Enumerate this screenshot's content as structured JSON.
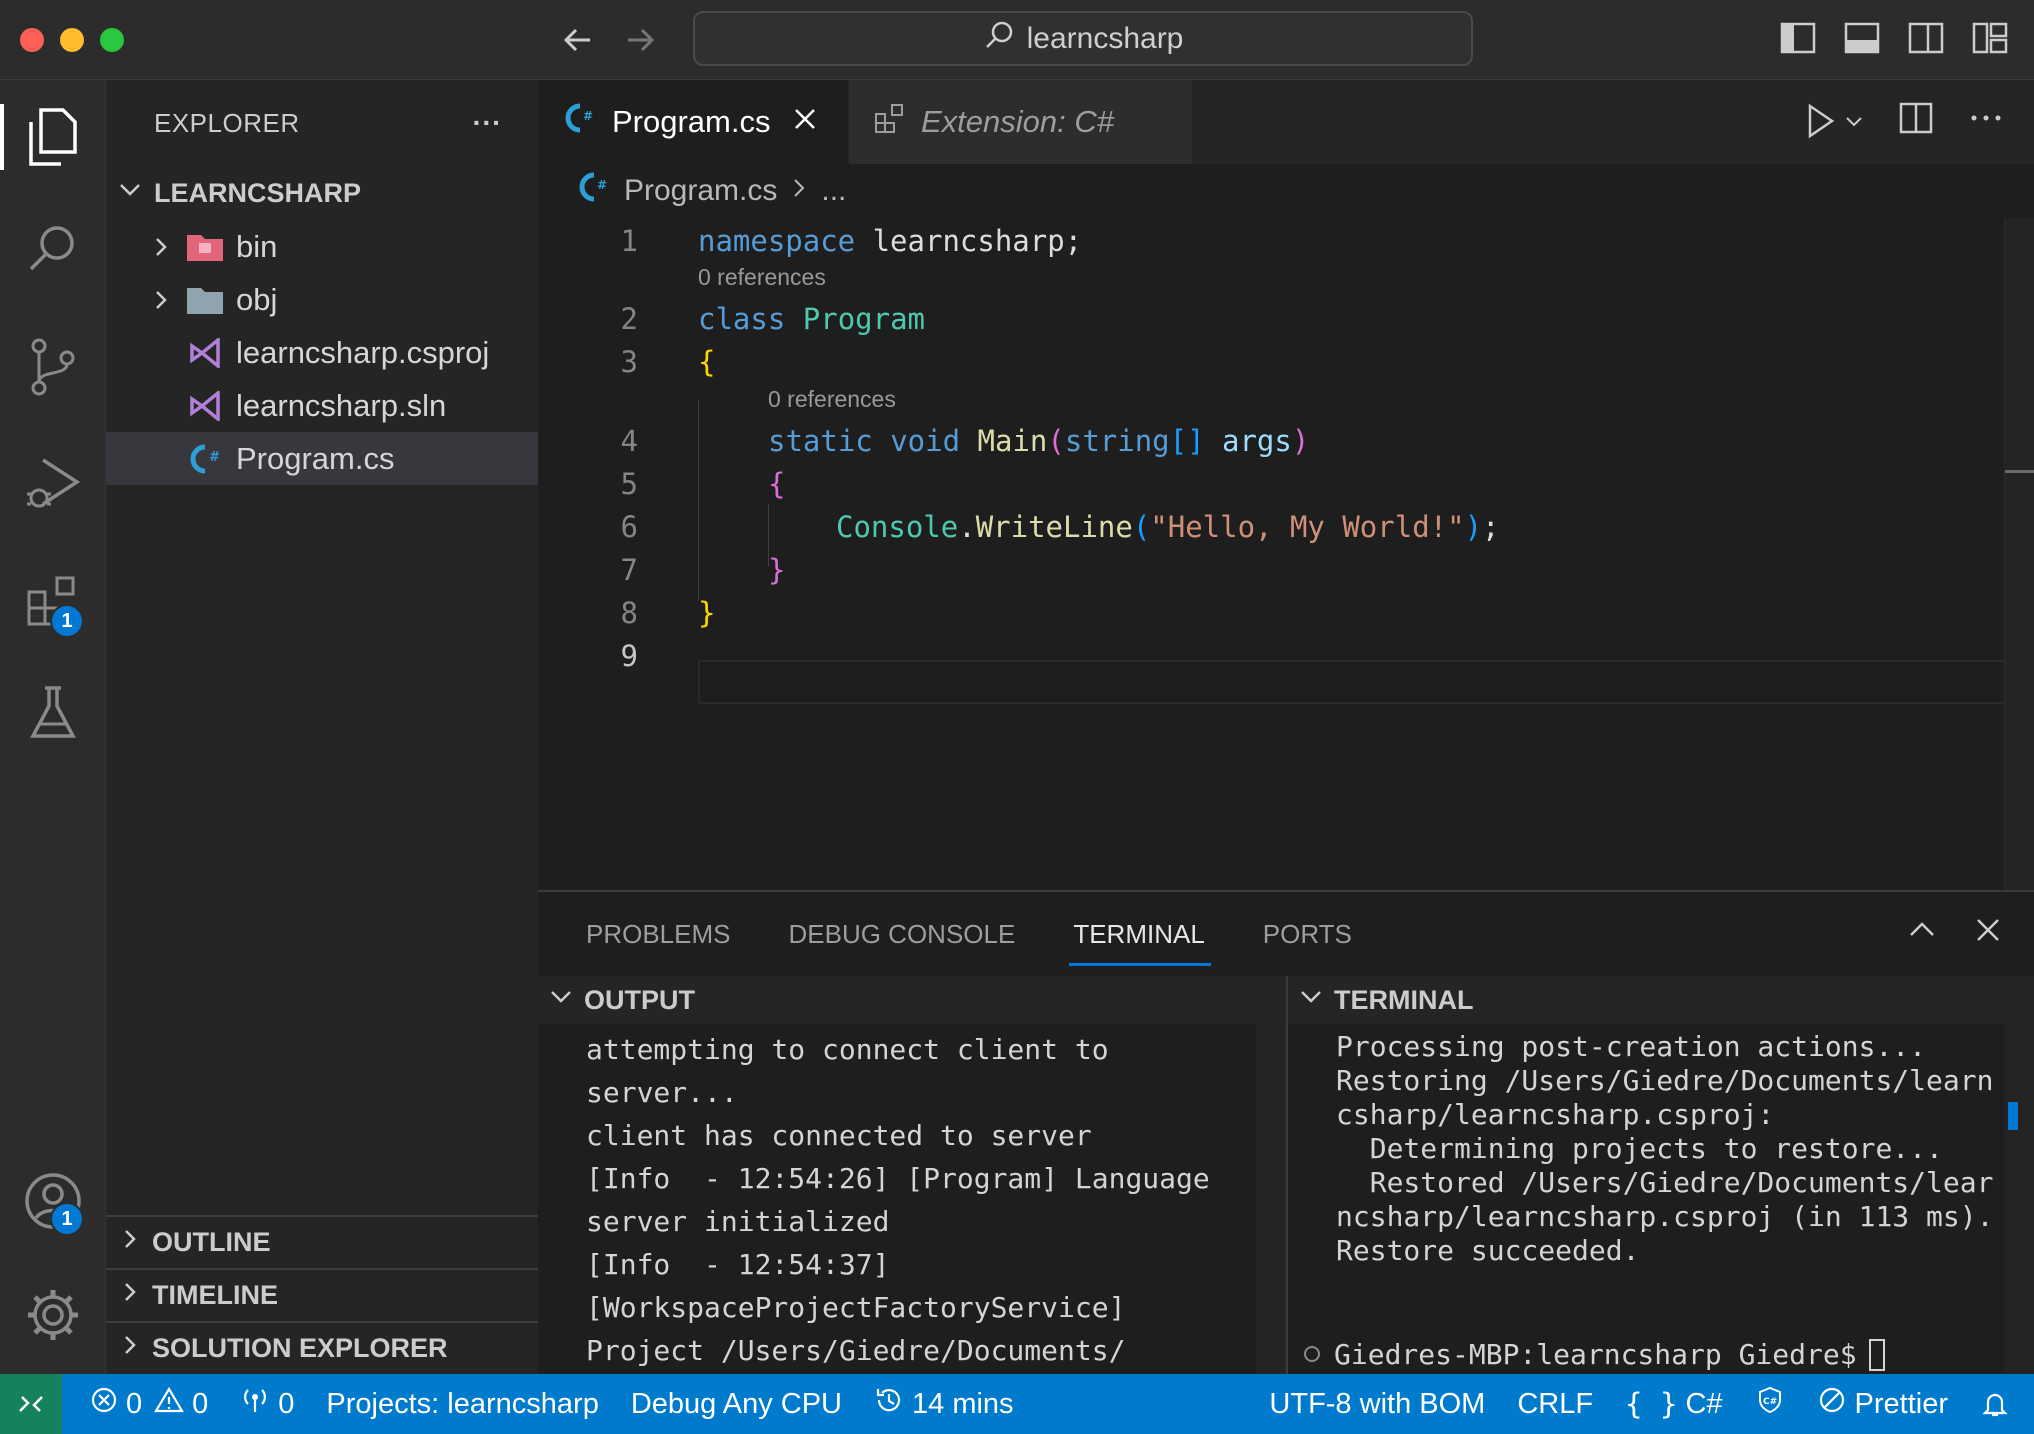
{
  "window": {
    "search_text": "learncsharp"
  },
  "activity": {
    "extensions_badge": "1",
    "accounts_badge": "1"
  },
  "explorer": {
    "header": "EXPLORER",
    "more": "···",
    "root": "LEARNCSHARP",
    "items": [
      {
        "label": "bin",
        "type": "folder-special"
      },
      {
        "label": "obj",
        "type": "folder"
      },
      {
        "label": "learncsharp.csproj",
        "type": "vs"
      },
      {
        "label": "learncsharp.sln",
        "type": "vs"
      },
      {
        "label": "Program.cs",
        "type": "cs"
      }
    ],
    "sections": [
      "OUTLINE",
      "TIMELINE",
      "SOLUTION EXPLORER"
    ]
  },
  "editor": {
    "tabs": [
      {
        "label": "Program.cs"
      },
      {
        "label": "Extension: C#"
      }
    ],
    "breadcrumb": {
      "file": "Program.cs",
      "rest": "..."
    },
    "codelens": [
      "0 references",
      "0 references"
    ],
    "line_numbers": [
      "1",
      "2",
      "3",
      "4",
      "5",
      "6",
      "7",
      "8",
      "9"
    ],
    "code": {
      "l1_kw": "namespace",
      "l1_rest": " learncsharp;",
      "l2_kw": "class",
      "l2_name": " Program",
      "l3": "{",
      "l4_static": "static",
      "l4_void": " void",
      "l4_main": " Main",
      "l4_paren_open": "(",
      "l4_string": "string",
      "l4_arr": "[]",
      "l4_args": " args",
      "l4_paren_close": ")",
      "l5": "{",
      "l6_console": "Console",
      "l6_dot": ".",
      "l6_method": "WriteLine",
      "l6_po": "(",
      "l6_str": "\"Hello, My World!\"",
      "l6_pc": ")",
      "l6_semi": ";",
      "l7": "}",
      "l8": "}"
    }
  },
  "panel": {
    "tabs": [
      "PROBLEMS",
      "DEBUG CONSOLE",
      "TERMINAL",
      "PORTS"
    ],
    "output": {
      "title": "OUTPUT",
      "lines": [
        "attempting to connect client to",
        "server...",
        "client has connected to server",
        "[Info  - 12:54:26] [Program] Language",
        "server initialized",
        "[Info  - 12:54:37]",
        "[WorkspaceProjectFactoryService]",
        "Project /Users/Giedre/Documents/"
      ]
    },
    "terminal": {
      "title": "TERMINAL",
      "lines": [
        "Processing post-creation actions...",
        "Restoring /Users/Giedre/Documents/learn",
        "csharp/learncsharp.csproj:",
        "  Determining projects to restore...",
        "  Restored /Users/Giedre/Documents/lear",
        "ncsharp/learncsharp.csproj (in 113 ms).",
        "Restore succeeded."
      ],
      "prompt": "Giedres-MBP:learncsharp Giedre$"
    }
  },
  "status": {
    "errors": "0",
    "warnings": "0",
    "ports": "0",
    "projects": "Projects: learncsharp",
    "config": "Debug Any CPU",
    "time": "14 mins",
    "encoding": "UTF-8 with BOM",
    "eol": "CRLF",
    "language": "C#",
    "prettier": "Prettier"
  }
}
